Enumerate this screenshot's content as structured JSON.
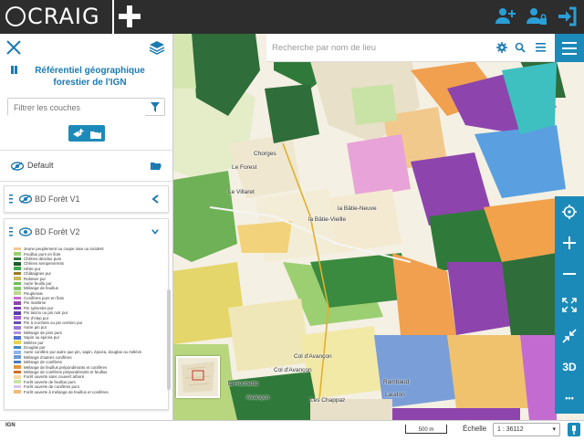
{
  "app": {
    "logo_text": "CRAIG"
  },
  "panel": {
    "title": "Référentiel géographique forestier de l'IGN",
    "filter_placeholder": "Filtrer les couches",
    "group_label": "Default",
    "layers": [
      {
        "label": "BD Forêt V1",
        "expanded": false
      },
      {
        "label": "BD Forêt V2",
        "expanded": true
      }
    ],
    "legend": [
      {
        "label": "Jeune peuplement ou coupe rase ou incident",
        "color": "#f3c79a"
      },
      {
        "label": "Feuillus purs en îlots",
        "color": "#9ccf72"
      },
      {
        "label": "Chênes décidus purs",
        "color": "#2f7a3a"
      },
      {
        "label": "Chênes sempervirents",
        "color": "#1d5c2e"
      },
      {
        "label": "Hêtre pur",
        "color": "#3ea84b"
      },
      {
        "label": "Châtaignier pur",
        "color": "#9b7a2f"
      },
      {
        "label": "Robinier pur",
        "color": "#c7b85a"
      },
      {
        "label": "Autre feuillu pur",
        "color": "#6cbf5a"
      },
      {
        "label": "Mélange de feuillus",
        "color": "#86c66c"
      },
      {
        "label": "Peupleraie",
        "color": "#b9d88a"
      },
      {
        "label": "Conifères purs en îlots",
        "color": "#c46bd1"
      },
      {
        "label": "Pin maritime",
        "color": "#8e44ad"
      },
      {
        "label": "Pin sylvestre pur",
        "color": "#7d3cb8"
      },
      {
        "label": "Pin laricio ou pin noir pur",
        "color": "#5b3fa8"
      },
      {
        "label": "Pin d'Alep pur",
        "color": "#a05fd0"
      },
      {
        "label": "Pin à crochets ou pin cembro pur",
        "color": "#6a4fb5"
      },
      {
        "label": "Autre pin pur",
        "color": "#9b7bd6"
      },
      {
        "label": "Mélange de pins purs",
        "color": "#b08ee0"
      },
      {
        "label": "Sapin ou épicéa pur",
        "color": "#4f6fd0"
      },
      {
        "label": "Mélèze pur",
        "color": "#e6d24f"
      },
      {
        "label": "Douglas pur",
        "color": "#3f88c5"
      },
      {
        "label": "Autre conifère pur autre que pin, sapin, épicéa, douglas ou mélèze",
        "color": "#8fb4e8"
      },
      {
        "label": "Mélange d'autres conifères",
        "color": "#6c9ad8"
      },
      {
        "label": "Mélange de conifères",
        "color": "#4a7dc0"
      },
      {
        "label": "Mélange de feuillus prépondérants et conifères",
        "color": "#e6953a"
      },
      {
        "label": "Mélange de conifères prépondérants et feuillus",
        "color": "#d36a2c"
      },
      {
        "label": "Forêt ouverte sans couvert arboré",
        "color": "#f2d9a8"
      },
      {
        "label": "Forêt ouverte de feuillus purs",
        "color": "#c9e3a6"
      },
      {
        "label": "Forêt ouverte de conifères purs",
        "color": "#d9c3ea"
      },
      {
        "label": "Forêt ouverte à mélange de feuillus et conifères",
        "color": "#f1b97a"
      }
    ]
  },
  "search": {
    "placeholder": "Recherche par nom de lieu"
  },
  "map": {
    "labels": [
      {
        "text": "Chorges",
        "key": "a"
      },
      {
        "text": "Le Forest",
        "key": "b"
      },
      {
        "text": "la Bâtie-Vieille",
        "key": "c"
      },
      {
        "text": "la Bâtie-Neuve",
        "key": "d"
      },
      {
        "text": "Le Villaret",
        "key": "e"
      },
      {
        "text": "Col d'Avançon",
        "key": "f"
      },
      {
        "text": "Col d'Avançon",
        "key": "g"
      },
      {
        "text": "la Rochette",
        "key": "h"
      },
      {
        "text": "Avançon",
        "key": "i"
      },
      {
        "text": "Les Chappaz",
        "key": "j"
      },
      {
        "text": "Rambaud",
        "key": "k"
      },
      {
        "text": "Laudon",
        "key": "l"
      }
    ],
    "tool_3d": "3D",
    "tool_more": "•••"
  },
  "footer": {
    "ign_logo": "IGN",
    "scale_bar": "500 m",
    "scale_label": "Échelle",
    "scale_value": "1 : 36112"
  },
  "colors": {
    "accent": "#1c8ab8",
    "topbar": "#2d2d2d"
  }
}
